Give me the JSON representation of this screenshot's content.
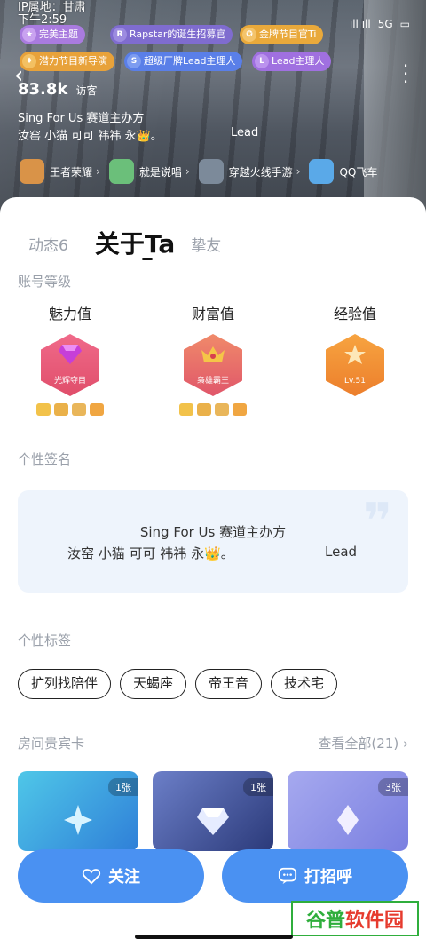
{
  "status_bar": {
    "ip_location": "IP属地：甘肃",
    "time": "下午2:59",
    "network": "5G",
    "signal": "ıll ıll"
  },
  "badges": [
    {
      "text": "完美主题",
      "color": "#a97bdf",
      "icon": "crown-icon"
    },
    {
      "text": "Rapstar的诞生招募官",
      "color": "#7f6ccf",
      "icon": "rapstar-icon"
    },
    {
      "text": "金牌节目官Ti",
      "color": "#e9a93b",
      "icon": "medal-icon"
    },
    {
      "text": "潜力节目新导演",
      "color": "#e8a23a",
      "icon": "director-icon"
    },
    {
      "text": "超级厂牌Lead主理人",
      "color": "#5a7fe8",
      "icon": "s-badge-icon"
    },
    {
      "text": "Lead主理人",
      "color": "#a070e0",
      "icon": "lead-icon"
    }
  ],
  "profile": {
    "visits_count": "83.8k",
    "visits_label": "访客",
    "signature_line1": "Sing For Us 赛道主办方",
    "signature_line2": "汝窑 小猫 可可 祎祎 永👑。",
    "signature_lead": "Lead"
  },
  "games": [
    {
      "name": "王者荣耀",
      "color": "#d99348"
    },
    {
      "name": "就是说唱",
      "color": "#6bbf7a"
    },
    {
      "name": "穿越火线手游",
      "color": "#7c8a9a"
    },
    {
      "name": "QQ飞车",
      "color": "#5aa9e8"
    }
  ],
  "tabs": [
    {
      "label": "动态6"
    },
    {
      "label": "关于Ta"
    },
    {
      "label": "挚友"
    }
  ],
  "account_level": {
    "title": "账号等级",
    "items": [
      {
        "name": "魅力值",
        "badge_text": "光辉夺目",
        "sub": "2",
        "color_top": "#f06a8a",
        "color_bottom": "#e04e6a"
      },
      {
        "name": "财富值",
        "badge_text": "枭雄霸王",
        "sub": "3",
        "color_top": "#f08a6a",
        "color_bottom": "#e0566a"
      },
      {
        "name": "经验值",
        "badge_text": "Lv.51",
        "sub": "",
        "color_top": "#f7a440",
        "color_bottom": "#ec7e2c"
      }
    ]
  },
  "signature_section": {
    "title": "个性签名",
    "line1": "Sing For Us 赛道主办方",
    "line2": "汝窑 小猫 可可 祎祎 永👑。",
    "lead": "Lead"
  },
  "tags_section": {
    "title": "个性标签",
    "tags": [
      "扩列找陪伴",
      "天蝎座",
      "帝王音",
      "技术宅"
    ]
  },
  "vip_cards": {
    "title": "房间贵宾卡",
    "view_all": "查看全部(21)",
    "cards": [
      {
        "count": "1张",
        "gradient_from": "#4fc7e8",
        "gradient_to": "#2f7fd8"
      },
      {
        "count": "1张",
        "gradient_from": "#6c7fc8",
        "gradient_to": "#2b3a7a"
      },
      {
        "count": "3张",
        "gradient_from": "#a6a9ef",
        "gradient_to": "#7a7fe0"
      }
    ]
  },
  "actions": {
    "follow": "关注",
    "greet": "打招呼"
  },
  "watermark": {
    "part_a": "谷普",
    "part_b": "软件园"
  }
}
